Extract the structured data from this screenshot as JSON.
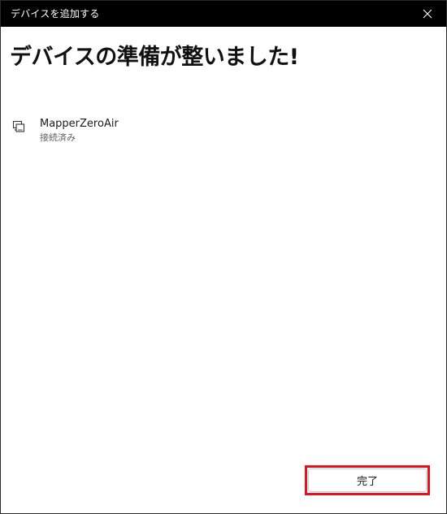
{
  "window": {
    "title": "デバイスを追加する",
    "close_icon": "close-icon"
  },
  "main": {
    "heading": "デバイスの準備が整いました!"
  },
  "device": {
    "icon": "device-icon",
    "name": "MapperZeroAir",
    "status": "接続済み"
  },
  "footer": {
    "done_label": "完了",
    "highlight_color": "#e3141f"
  }
}
